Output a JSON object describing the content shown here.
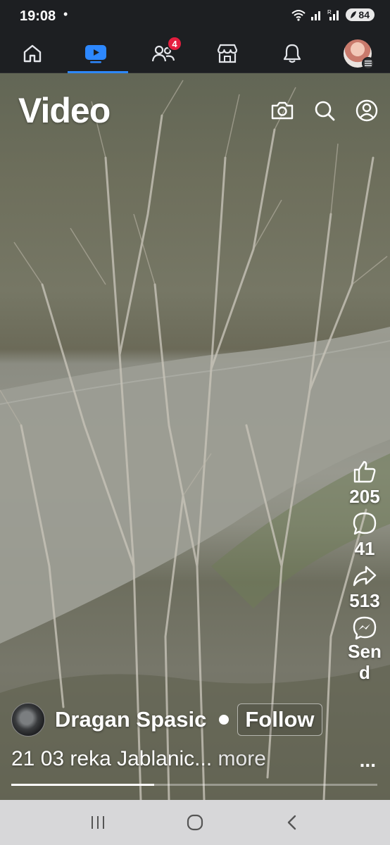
{
  "status_bar": {
    "time": "19:08",
    "dot": "•",
    "battery": "84"
  },
  "nav": {
    "items": [
      {
        "icon": "home-icon"
      },
      {
        "icon": "video-icon",
        "active": true
      },
      {
        "icon": "friends-icon",
        "badge": "4"
      },
      {
        "icon": "marketplace-icon"
      },
      {
        "icon": "bell-icon"
      },
      {
        "icon": "profile-avatar"
      }
    ]
  },
  "page": {
    "title": "Video"
  },
  "actions": {
    "like_count": "205",
    "comment_count": "41",
    "share_count": "513",
    "send_label": "Send",
    "more": "..."
  },
  "post": {
    "author": "Dragan Spasic",
    "follow_label": "Follow",
    "caption": "21 03 reka Jablanic...",
    "more_label": "more",
    "progress": 0.39
  },
  "colors": {
    "accent": "#2d88ff",
    "badge": "#e41e3f",
    "bar_bg": "#1d1f22"
  }
}
